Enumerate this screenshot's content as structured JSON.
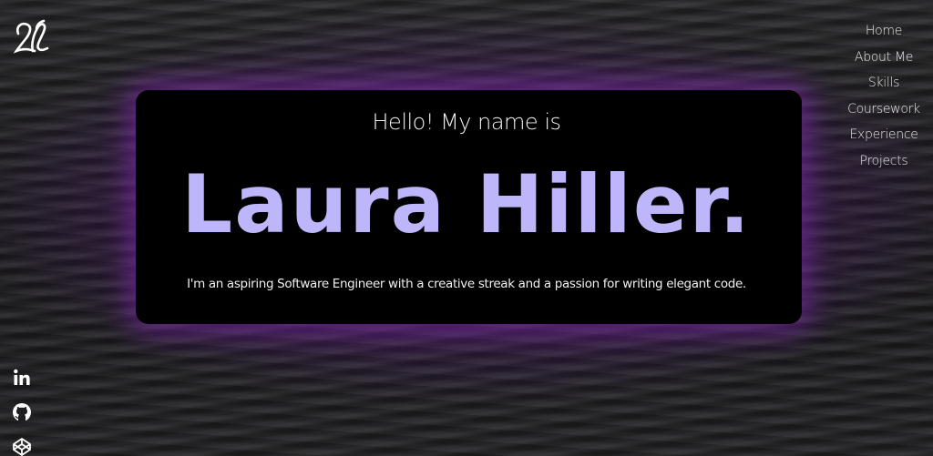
{
  "logo": {
    "icon": "script-monogram-logo",
    "color": "#ffffff"
  },
  "nav": {
    "items": [
      {
        "label": "Home"
      },
      {
        "label": "About Me"
      },
      {
        "label": "Skills"
      },
      {
        "label": "Coursework"
      },
      {
        "label": "Experience"
      },
      {
        "label": "Projects"
      }
    ]
  },
  "hero": {
    "greeting": "Hello! My name is",
    "name": "Laura Hiller.",
    "tagline": "I'm an aspiring Software Engineer with a creative streak and a passion for writing elegant code."
  },
  "social": {
    "icons": [
      "linkedin-icon",
      "github-icon",
      "codepen-icon"
    ]
  },
  "colors": {
    "accent_name": "#bdb6fb",
    "glow": "#8a28b9",
    "card_background": "#000000",
    "text": "#f2f2f2"
  }
}
